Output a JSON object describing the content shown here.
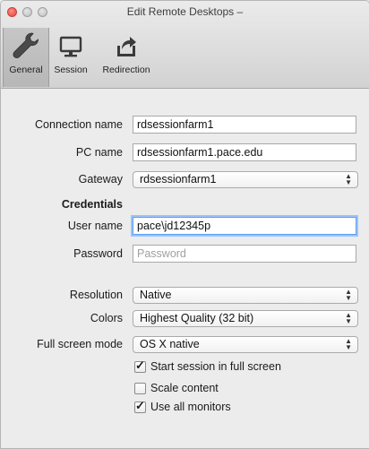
{
  "window": {
    "title": "Edit Remote Desktops –"
  },
  "tabs": [
    {
      "label": "General",
      "icon": "wrench-icon",
      "selected": true
    },
    {
      "label": "Session",
      "icon": "monitor-icon",
      "selected": false
    },
    {
      "label": "Redirection",
      "icon": "folder-share-icon",
      "selected": false
    }
  ],
  "form": {
    "connection_name": {
      "label": "Connection name",
      "value": "rdsessionfarm1"
    },
    "pc_name": {
      "label": "PC name",
      "value": "rdsessionfarm1.pace.edu"
    },
    "gateway": {
      "label": "Gateway",
      "value": "rdsessionfarm1"
    },
    "credentials_heading": "Credentials",
    "user_name": {
      "label": "User name",
      "value": "pace\\jd12345p"
    },
    "password": {
      "label": "Password",
      "value": "",
      "placeholder": "Password"
    },
    "resolution": {
      "label": "Resolution",
      "value": "Native"
    },
    "colors": {
      "label": "Colors",
      "value": "Highest Quality (32 bit)"
    },
    "full_screen_mode": {
      "label": "Full screen mode",
      "value": "OS X native"
    },
    "start_full_screen": {
      "label": "Start session in full screen",
      "checked": true
    },
    "scale_content": {
      "label": "Scale content",
      "checked": false
    },
    "use_all_monitors": {
      "label": "Use all monitors",
      "checked": true
    }
  },
  "colors": {
    "focus_ring": "#5b9ef6",
    "close_button": "#e0463e"
  }
}
